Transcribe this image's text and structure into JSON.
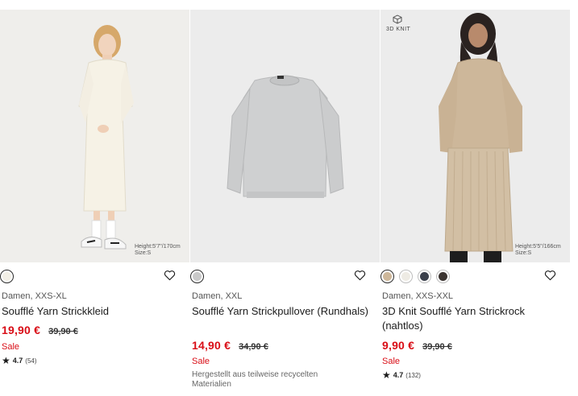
{
  "products": [
    {
      "sizes": "Damen, XXS-XL",
      "title": "Soufflé Yarn Strickkleid",
      "price": "19,90 €",
      "old_price": "39,90 €",
      "sale": "Sale",
      "rating": "4.7",
      "reviews": "(54)",
      "model_height": "Height:5'7\"/170cm",
      "model_size": "Size:S",
      "swatches": [
        "#f2efe6"
      ]
    },
    {
      "sizes": "Damen, XXL",
      "title": "Soufflé Yarn Strickpullover (Rundhals)",
      "price": "14,90 €",
      "old_price": "34,90 €",
      "sale": "Sale",
      "note": "Hergestellt aus teilweise recycelten Materialien",
      "swatches": [
        "#c9c9c9"
      ]
    },
    {
      "sizes": "Damen, XXS-XXL",
      "title": "3D Knit Soufflé Yarn Strickrock (nahtlos)",
      "price": "9,90 €",
      "old_price": "39,90 €",
      "sale": "Sale",
      "rating": "4.7",
      "reviews": "(132)",
      "badge": "3D KNIT",
      "model_height": "Height:5'5\"/166cm",
      "model_size": "Size:S",
      "swatches": [
        "#cdb79a",
        "#eeebe4",
        "#3a3f4b",
        "#3b3431"
      ]
    }
  ],
  "icons": {
    "heart": "heart-outline-icon",
    "star": "star-icon"
  },
  "colors": {
    "sale_red": "#d90d16",
    "text": "#1b1b1b"
  }
}
